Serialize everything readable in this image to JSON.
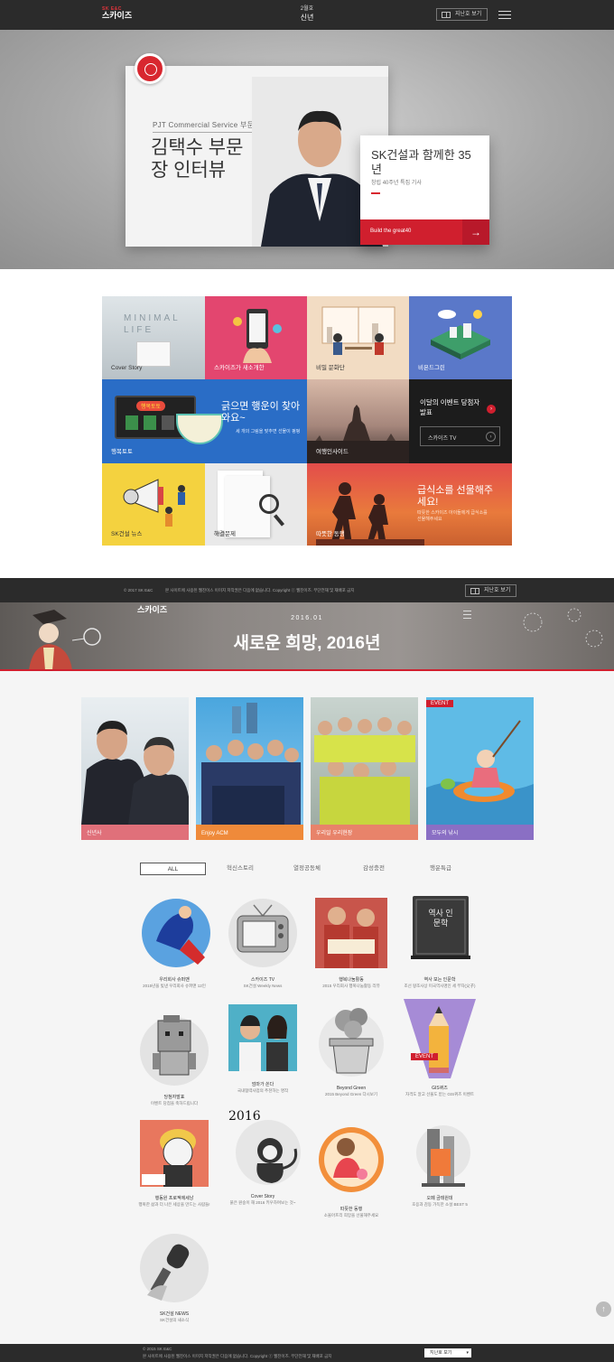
{
  "topbar": {
    "logo_sup": "SK E&C",
    "logo": "스카이즈",
    "issue_month": "2월호",
    "issue_title": "신년",
    "prev_label": "지난호 보기"
  },
  "hero": {
    "card_subtitle": "PJT Commercial Service 부문",
    "card_title": "김택수 부문장 인터뷰",
    "side_title": "SK건설과 함께한 35년",
    "side_sub": "창립 40주년 특집 기사",
    "side_foot": "Build the great40",
    "arrow": "→"
  },
  "tiles": [
    {
      "label": "Cover Story",
      "art": "MINIMAL LIFE"
    },
    {
      "label": "스카이즈가 새소개한"
    },
    {
      "label": "비밀 문화단"
    },
    {
      "label": "비욘드그린"
    },
    {
      "label": "행복토토",
      "headline": "긁으면 행운이 찾아와요~",
      "sub": "세 개의 그림을 맞추면 선물이 펑펑",
      "badge": "행복토토"
    },
    {
      "label": "여행인사이드"
    },
    {
      "label": "",
      "event_title": "이달의 이벤트 당첨자 발표",
      "tv_label": "스카이즈 TV"
    },
    {
      "label": "SK건설 뉴스"
    },
    {
      "label": "해결문제"
    },
    {
      "label": "따뜻한 동행",
      "headline": "급식소를 선물해주세요!",
      "sub": "따뜻한 스카이즈 아이들에게 급식소를 선물해주세요"
    }
  ],
  "footbar": {
    "copy": "© 2017 SK E&C",
    "notice": "본 사이트에 사용된 웹진이스 이미지 저작권은 다음에 없습니다. Copyright ⓒ 웹진이즈. 무단전재 및 재배포 금지",
    "prev_label": "지난호 보기"
  },
  "banner": {
    "logo": "스카이즈",
    "date": "2016.01",
    "title": "새로운 희망, 2016년"
  },
  "features": [
    {
      "label": "신년사",
      "color": "#e0707a"
    },
    {
      "label": "Enjoy ACM",
      "color": "#ef8a3a"
    },
    {
      "label": "우리일 우리현장",
      "color": "#e8836a"
    },
    {
      "label": "모두의 낚시",
      "color": "#8a6fc4",
      "event": "EVENT"
    }
  ],
  "tabs": [
    "ALL",
    "혁신스토리",
    "열정공동체",
    "감성충전",
    "행운특급"
  ],
  "stories": [
    {
      "title": "우리회사 슈퍼맨",
      "sub": "2015년을 빛낸 우리회사 슈퍼맨 12인"
    },
    {
      "title": "스카이즈 TV",
      "sub": "SK건설 Weekly News"
    },
    {
      "title": "행복나눔활동",
      "sub": "2015 우리회사 행복나눔활동 리뷰"
    },
    {
      "title": "역사 보는 인문학",
      "sub": "조선 왕조사상 미국역사명인 세 부자(父子)",
      "book_text": "역사 인문학"
    },
    {
      "title": "당첨자발표",
      "sub": "이벤트 당첨을 축하드립니다"
    },
    {
      "title": "엄마가 쏜다",
      "sub": "국내협력사업의 추천하는 명작"
    },
    {
      "title": "Beyond Green",
      "sub": "2015 Beyond Green 다시보기"
    },
    {
      "title": "GIS퀴즈",
      "sub": "자격도 알고 선물도 받는 GIS퀴즈 이벤트",
      "event": "EVENT"
    },
    {
      "title": "행동원 프로젝에세낭",
      "sub": "행복한 삶과 더 나은 세상을 만드는 사람들!"
    },
    {
      "title": "Cover Story",
      "sub": "붉은 원숭이 해 2016 키우하며보는 것~",
      "art": "2016"
    },
    {
      "title": "따뜻한 동행",
      "sub": "소울아프리 희망을 선물해주세요"
    },
    {
      "title": "오페 금테원데",
      "sub": "호응과 감동 가득한 소설 BEST 5"
    },
    {
      "title": "SK건설 NEWS",
      "sub": "SK건설의 새소식"
    }
  ],
  "bottombar": {
    "copy": "© 2015 SK E&C",
    "notice": "본 사이트에 사용된 웹진이스 이미지 저작권은 다음에 없습니다. Copyright ⓒ 웹진이즈. 무단전재 및 재배포 금지",
    "select_value": "지난호 보기"
  },
  "colors": {
    "accent": "#d01f2e",
    "dark": "#2b2b2b"
  }
}
